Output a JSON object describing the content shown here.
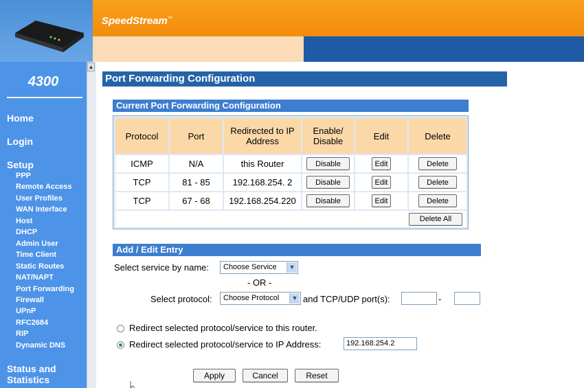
{
  "brand": {
    "name": "SpeedStream",
    "mark": "™",
    "model": "4300"
  },
  "nav": {
    "home": "Home",
    "login": "Login",
    "setup": "Setup",
    "setup_items": [
      "PPP",
      "Remote Access",
      "User Profiles",
      "WAN Interface",
      "Host",
      "DHCP",
      "Admin User",
      "Time Client",
      "Static Routes",
      "NAT/NAPT",
      "Port Forwarding",
      "Firewall",
      "UPnP",
      "RFC2684",
      "RIP",
      "Dynamic DNS"
    ],
    "status": "Status and Statistics"
  },
  "page": {
    "title": "Port Forwarding Configuration"
  },
  "current": {
    "title": "Current Port Forwarding Configuration",
    "headers": {
      "protocol": "Protocol",
      "port": "Port",
      "redirect": "Redirected to IP Address",
      "enable": "Enable/ Disable",
      "edit": "Edit",
      "delete": "Delete"
    },
    "rows": [
      {
        "protocol": "ICMP",
        "port": "N/A",
        "ip": "this Router",
        "toggle": "Disable",
        "edit": "Edit",
        "delete": "Delete"
      },
      {
        "protocol": "TCP",
        "port": "81 - 85",
        "ip": "192.168.254. 2",
        "toggle": "Disable",
        "edit": "Edit",
        "delete": "Delete"
      },
      {
        "protocol": "TCP",
        "port": "67 - 68",
        "ip": "192.168.254.220",
        "toggle": "Disable",
        "edit": "Edit",
        "delete": "Delete"
      }
    ],
    "delete_all": "Delete All"
  },
  "entry": {
    "title": "Add / Edit Entry",
    "service_label": "Select service by name:",
    "service_value": "Choose Service",
    "or": "- OR -",
    "protocol_label": "Select protocol:",
    "protocol_value": "Choose Protocol",
    "port_label": "and TCP/UDP port(s):",
    "port_sep": "-",
    "port_start": "",
    "port_end": "",
    "radio_router": "Redirect selected protocol/service to this router.",
    "radio_ip": "Redirect selected protocol/service to IP Address:",
    "ip_value": "192.168.254.2"
  },
  "actions": {
    "apply": "Apply",
    "cancel": "Cancel",
    "reset": "Reset"
  }
}
